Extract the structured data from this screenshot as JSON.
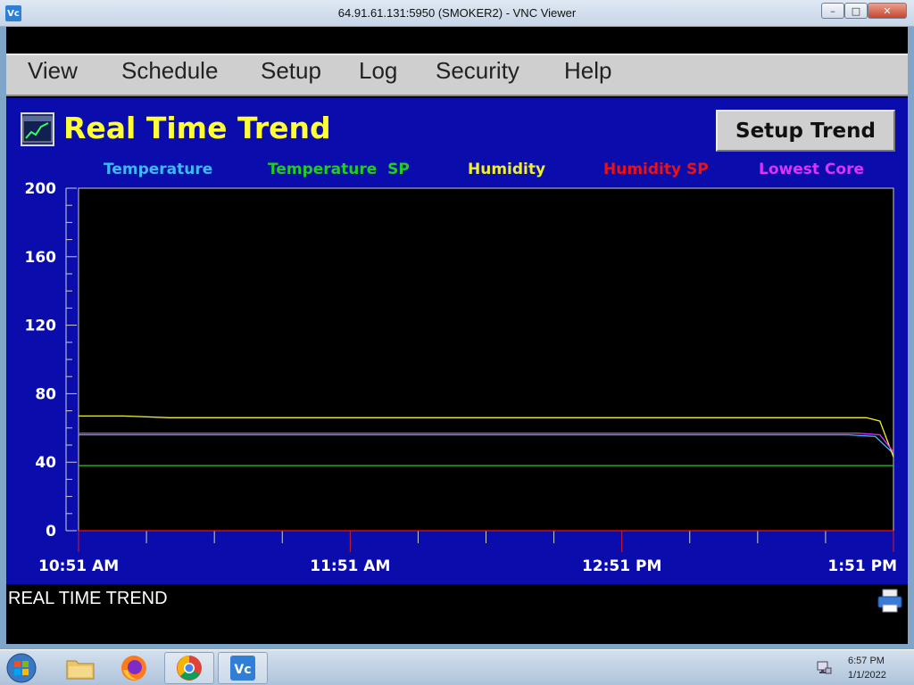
{
  "window": {
    "title": "64.91.61.131:5950 (SMOKER2) - VNC Viewer",
    "app_icon": "Vc",
    "min_glyph": "–",
    "max_glyph": "□",
    "close_glyph": "✕"
  },
  "menu": [
    "View",
    "Schedule",
    "Setup",
    "Log",
    "Security",
    "Help"
  ],
  "page": {
    "title": "Real Time Trend",
    "setup_button": "Setup Trend",
    "status": "REAL TIME TREND"
  },
  "colors": {
    "panel": "#0a0dac",
    "title": "#ffff33",
    "temperature": "#3fb8ff",
    "temperature_sp": "#22cc22",
    "humidity": "#eeee33",
    "humidity_sp": "#ee1111",
    "lowest_core": "#dd33ff"
  },
  "chart_data": {
    "type": "line",
    "title": "Real Time Trend",
    "xlabel": "",
    "ylabel": "",
    "ylim": [
      0,
      200
    ],
    "yticks": [
      0,
      40,
      80,
      120,
      160,
      200
    ],
    "x_start": "10:51 AM",
    "x_end": "1:51 PM",
    "xticks": [
      "10:51 AM",
      "11:51 AM",
      "12:51 PM",
      "1:51 PM"
    ],
    "x_minutes_span": 180,
    "legend_position": "top",
    "grid": false,
    "series": [
      {
        "name": "Temperature",
        "color": "#3fb8ff",
        "points": [
          [
            0,
            56
          ],
          [
            170,
            56
          ],
          [
            176,
            55
          ],
          [
            180,
            45
          ]
        ]
      },
      {
        "name": "Temperature  SP",
        "color": "#22cc22",
        "points": [
          [
            0,
            38
          ],
          [
            180,
            38
          ]
        ]
      },
      {
        "name": "Humidity",
        "color": "#eeee33",
        "points": [
          [
            0,
            67
          ],
          [
            10,
            67
          ],
          [
            20,
            66
          ],
          [
            40,
            66
          ],
          [
            60,
            66
          ],
          [
            80,
            66
          ],
          [
            100,
            66
          ],
          [
            120,
            66
          ],
          [
            140,
            66
          ],
          [
            160,
            66
          ],
          [
            174,
            66
          ],
          [
            177,
            64
          ],
          [
            180,
            43
          ]
        ]
      },
      {
        "name": "Humidity SP",
        "color": "#ee1111",
        "points": [
          [
            0,
            0
          ],
          [
            180,
            0
          ]
        ]
      },
      {
        "name": "Lowest Core",
        "color": "#dd33ff",
        "points": [
          [
            0,
            57
          ],
          [
            172,
            57
          ],
          [
            177,
            56
          ],
          [
            180,
            46
          ]
        ]
      }
    ]
  },
  "taskbar": {
    "time": "6:57 PM",
    "date": "1/1/2022",
    "vnc_label": "Vc"
  },
  "icons": [
    "windows-start-icon",
    "folder-icon",
    "firefox-icon",
    "chrome-icon",
    "vnc-icon",
    "network-icon",
    "printer-icon",
    "trend-icon"
  ]
}
